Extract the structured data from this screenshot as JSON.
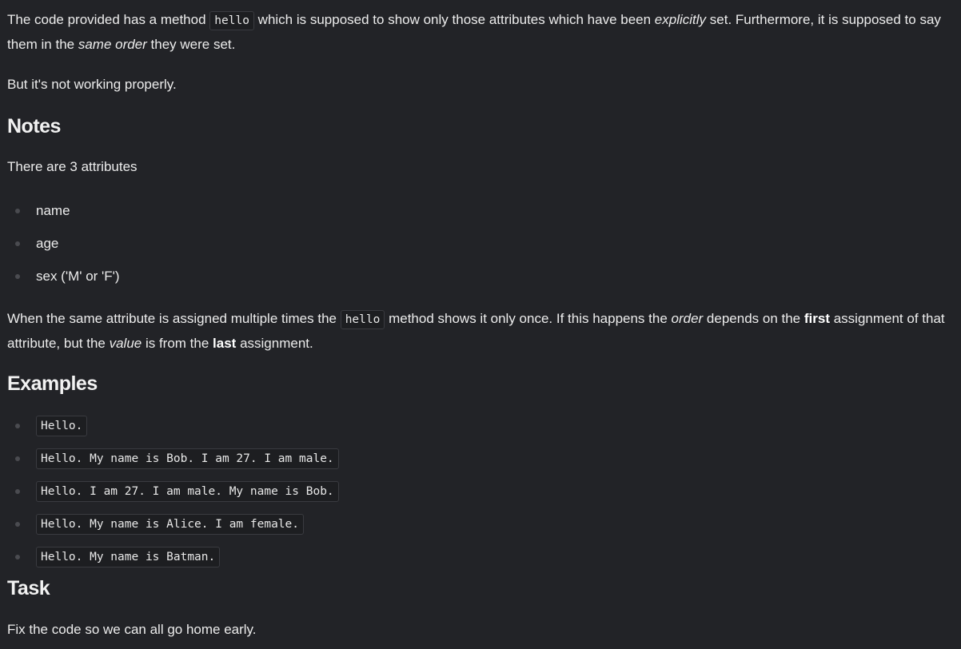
{
  "intro": {
    "t1": "The code provided has a method ",
    "code": "hello",
    "t2": " which is supposed to show only those attributes which have been ",
    "em1": "explicitly",
    "t3": " set. Furthermore, it is supposed to say them in the ",
    "em2": "same order",
    "t4": " they were set."
  },
  "not_working": "But it's not working properly.",
  "notes": {
    "heading": "Notes",
    "intro": "There are 3 attributes",
    "attributes": [
      "name",
      "age",
      "sex ('M' or 'F')"
    ],
    "para": {
      "t1": "When the same attribute is assigned multiple times the ",
      "code": "hello",
      "t2": " method shows it only once. If this happens the ",
      "em1": "order",
      "t3": " depends on the ",
      "strong1": "first",
      "t4": " assignment of that attribute, but the ",
      "em2": "value",
      "t5": " is from the ",
      "strong2": "last",
      "t6": " assignment."
    }
  },
  "examples": {
    "heading": "Examples",
    "items": [
      "Hello.",
      "Hello. My name is Bob. I am 27. I am male.",
      "Hello. I am 27. I am male. My name is Bob.",
      "Hello. My name is Alice. I am female.",
      "Hello. My name is Batman."
    ]
  },
  "task": {
    "heading": "Task",
    "text": "Fix the code so we can all go home early."
  }
}
